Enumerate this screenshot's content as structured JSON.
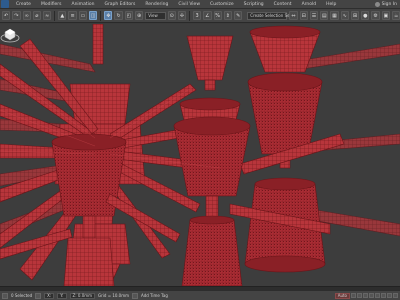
{
  "menu": {
    "items": [
      "Create",
      "Modifiers",
      "Animation",
      "Graph Editors",
      "Rendering",
      "Civil View",
      "Customize",
      "Scripting",
      "Content",
      "Arnold",
      "Help"
    ],
    "sign_in": "Sign In"
  },
  "toolbar": {
    "view_dropdown": "View",
    "selection_set": "Create Selection Se"
  },
  "statusbar": {
    "status": "0 Selected",
    "x": "X:",
    "y": "Y:",
    "z": "Z: 0.0mm",
    "grid": "Grid = 10.0mm",
    "add_time_tag": "Add Time Tag",
    "auto_key": "Auto"
  },
  "colors": {
    "wire": "#b8353b",
    "wire_dark": "#7d1f24",
    "viewport_bg": "#3d3d3d"
  }
}
